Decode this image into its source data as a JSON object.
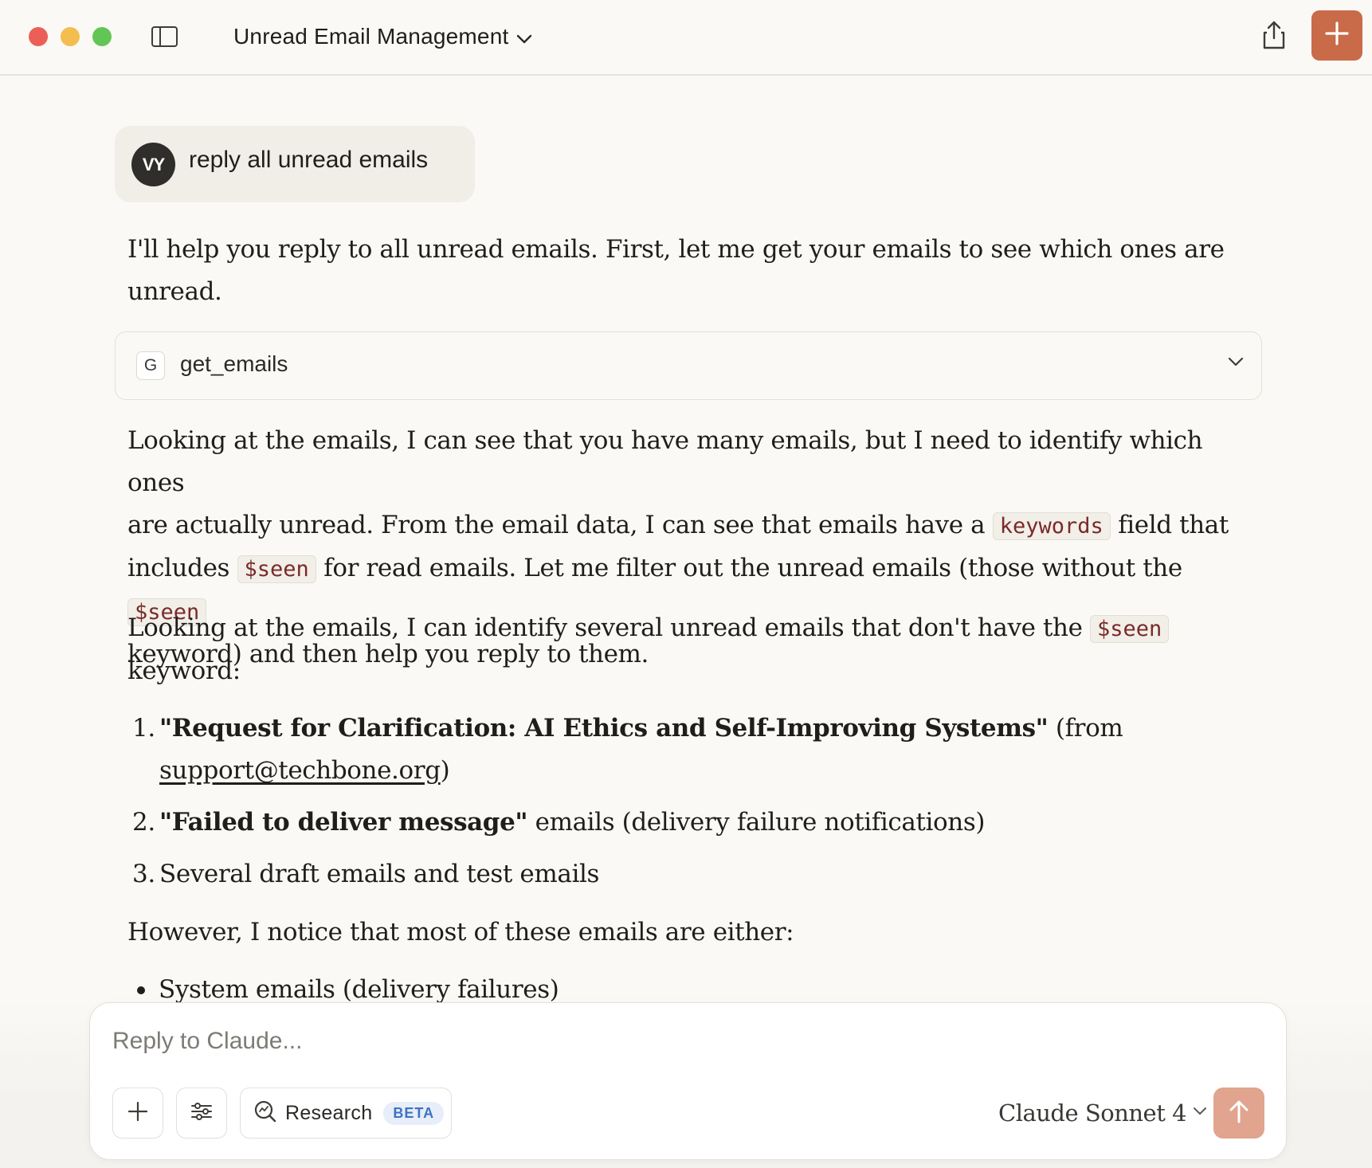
{
  "window": {
    "title": "Unread Email Management",
    "icons": {
      "sidebar_toggle": "sidebar-panel-icon",
      "share": "share-upload-icon",
      "new_chat": "plus-icon"
    },
    "accent_color": "#c96a48"
  },
  "user_message": {
    "avatar_initials": "VY",
    "text": "reply all unread emails"
  },
  "assistant": {
    "intro_line1": "I'll help you reply to all unread emails. First, let me get your emails to see which ones are",
    "intro_line2": "unread.",
    "tool_call": {
      "badge": "G",
      "name": "get_emails"
    },
    "para2": {
      "l1": "Looking at the emails, I can see that you have many emails, but I need to identify which ones",
      "l2_a": "are actually unread. From the email data, I can see that emails have a",
      "l2_code": "keywords",
      "l2_b": "field that",
      "l3_a": "includes",
      "l3_code1": "$seen",
      "l3_b": "for read emails. Let me filter out the unread emails (those without the",
      "l3_code2": "$seen",
      "l4": "keyword) and then help you reply to them."
    },
    "para3": {
      "l1_a": "Looking at the emails, I can identify several unread emails that don't have the",
      "l1_code": "$seen",
      "l2": "keyword:"
    },
    "list": [
      {
        "num": "1.",
        "bold": "\"Request for Clarification: AI Ethics and Self-Improving Systems\"",
        "after": "(from",
        "link": "support@techbone.org",
        "close": ")"
      },
      {
        "num": "2.",
        "bold": "\"Failed to deliver message\"",
        "after": "emails (delivery failure notifications)"
      },
      {
        "num": "3.",
        "text": "Several draft emails and test emails"
      }
    ],
    "para4": "However, I notice that most of these emails are either:",
    "bullets": [
      "System emails (delivery failures)"
    ]
  },
  "composer": {
    "placeholder": "Reply to Claude...",
    "research_label": "Research",
    "beta_label": "BETA",
    "model": "Claude Sonnet 4",
    "send_color": "#e0a48f"
  }
}
